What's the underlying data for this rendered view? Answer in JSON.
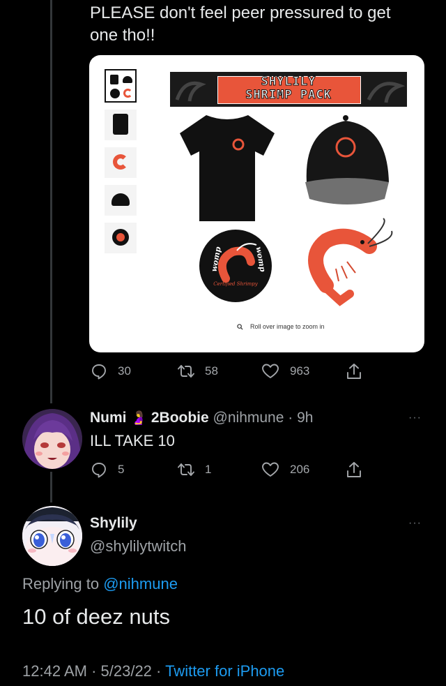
{
  "colors": {
    "background": "#000000",
    "text": "#e7e9ea",
    "muted": "#9ea2a6",
    "link": "#1d9bf0",
    "thread_line": "#333639",
    "shrimp": "#e8553a"
  },
  "tweet1": {
    "text_line1": "PLEASE don't feel peer pressured to get",
    "text_line2": "one tho!!",
    "media": {
      "banner_line1": "SHYLILY",
      "banner_line2": "SHRIMP PACK",
      "sticker_top": "womp",
      "sticker_right": "womp",
      "sticker_caption": "Certified Shrimpy",
      "zoom_hint": "Roll over image to zoom in"
    },
    "replies": "30",
    "retweets": "58",
    "likes": "963"
  },
  "reply": {
    "display_name_part1": "Numi",
    "display_name_emoji": "🤰",
    "display_name_part2": "2Boobie",
    "handle": "@nihmune",
    "time": "9h",
    "text": "ILL TAKE 10",
    "replies": "5",
    "retweets": "1",
    "likes": "206"
  },
  "main_tweet": {
    "display_name": "Shylily",
    "handle": "@shylilytwitch",
    "replying_label": "Replying to",
    "replying_handle": "@nihmune",
    "text": "10 of deez nuts",
    "time": "12:42 AM",
    "date": "5/23/22",
    "client": "Twitter for iPhone"
  }
}
